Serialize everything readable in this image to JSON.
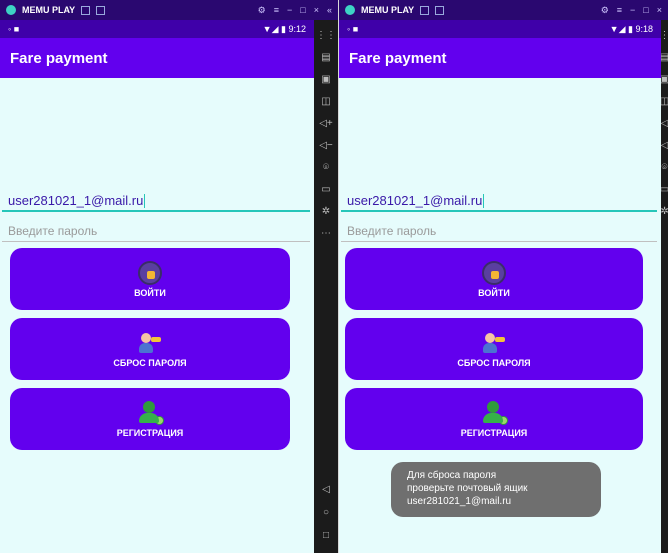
{
  "left": {
    "emulator": {
      "title": "MEMU PLAY"
    },
    "status": {
      "time": "9:12"
    },
    "app": {
      "title": "Fare payment"
    },
    "login": {
      "email_value": "user281021_1@mail.ru",
      "password_placeholder": "Введите пароль"
    },
    "buttons": {
      "login": "ВОЙТИ",
      "reset": "СБРОС ПАРОЛЯ",
      "register": "РЕГИСТРАЦИЯ"
    }
  },
  "right": {
    "emulator": {
      "title": "MEMU PLAY"
    },
    "status": {
      "time": "9:18"
    },
    "app": {
      "title": "Fare payment"
    },
    "login": {
      "email_value": "user281021_1@mail.ru",
      "password_placeholder": "Введите пароль"
    },
    "buttons": {
      "login": "ВОЙТИ",
      "reset": "СБРОС ПАРОЛЯ",
      "register": "РЕГИСТРАЦИЯ"
    },
    "toast": {
      "line1": "Для сброса пароля",
      "line2": "проверьте почтовый ящик",
      "line3": "user281021_1@mail.ru"
    }
  },
  "colors": {
    "primary": "#6200ee",
    "status": "#3f00a9",
    "accent": "#26c6b9",
    "background": "#e6fcfc"
  }
}
